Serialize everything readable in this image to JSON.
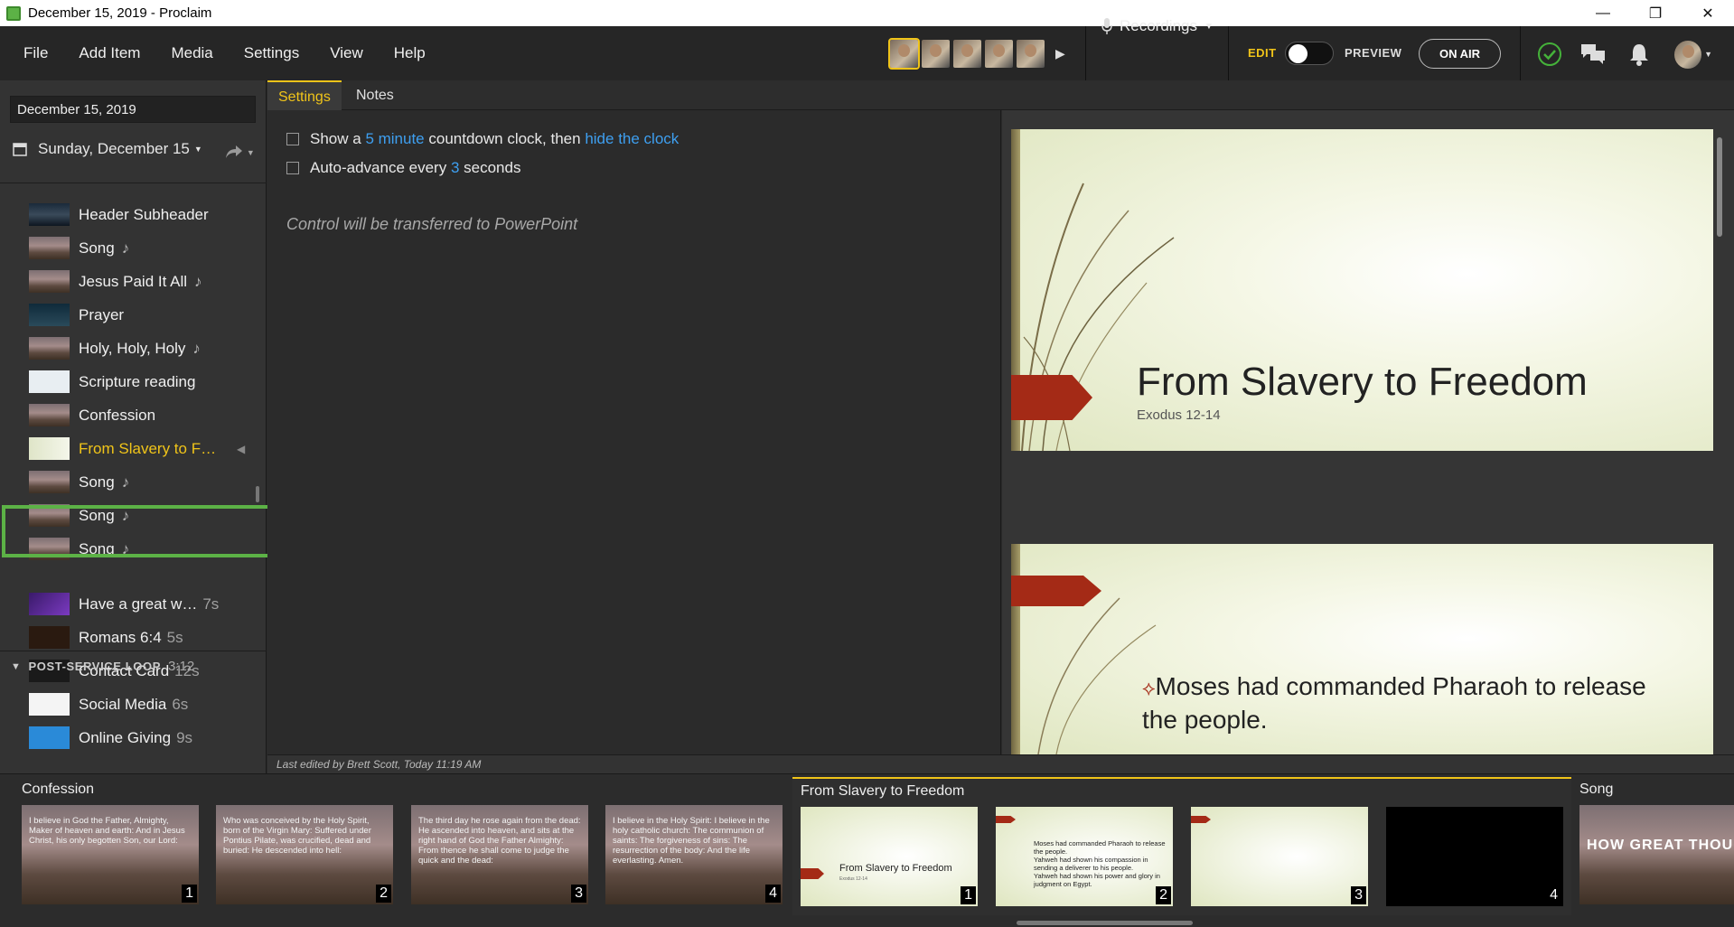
{
  "window": {
    "title": "December 15, 2019 - Proclaim",
    "controls": [
      "—",
      "❐",
      "✕"
    ]
  },
  "menu": [
    "File",
    "Add Item",
    "Media",
    "Settings",
    "View",
    "Help"
  ],
  "toolbar": {
    "recordings_label": "Recordings",
    "edit_label": "EDIT",
    "preview_label": "PREVIEW",
    "onair_label": "ON AIR"
  },
  "sidebar": {
    "date_field": "December 15, 2019",
    "date_selector": "Sunday, December 15",
    "items": [
      {
        "label": "Header Subheader",
        "thumb": "t-dark",
        "music": ""
      },
      {
        "label": "Song",
        "thumb": "t-mtn",
        "music": "♪"
      },
      {
        "label": "Jesus Paid It All",
        "thumb": "t-mtn",
        "music": "♪"
      },
      {
        "label": "Prayer",
        "thumb": "t-pray",
        "music": ""
      },
      {
        "label": "Holy, Holy, Holy",
        "thumb": "t-mtn",
        "music": "♪"
      },
      {
        "label": "Scripture reading",
        "thumb": "t-doc",
        "music": ""
      },
      {
        "label": "Confession",
        "thumb": "t-mtn",
        "music": ""
      },
      {
        "label": "From Slavery to F…",
        "thumb": "t-slide",
        "music": "",
        "selected": true
      },
      {
        "label": "Song",
        "thumb": "t-mtn",
        "music": "♪"
      },
      {
        "label": "Song",
        "thumb": "t-mtn",
        "music": "♪"
      },
      {
        "label": "Song",
        "thumb": "t-mtn",
        "music": "♪"
      }
    ],
    "section": {
      "name": "POST-SERVICE LOOP",
      "duration": "3:12"
    },
    "loop_items": [
      {
        "label": "Have a great w…",
        "duration": "7s",
        "thumb": "t-purple"
      },
      {
        "label": "Romans 6:4",
        "duration": "5s",
        "thumb": "t-romans"
      },
      {
        "label": "Contact Card",
        "duration": "12s",
        "thumb": "t-contact"
      },
      {
        "label": "Social Media",
        "duration": "6s",
        "thumb": "t-social"
      },
      {
        "label": "Online Giving",
        "duration": "9s",
        "thumb": "t-give"
      }
    ]
  },
  "tabs": [
    "Settings",
    "Notes"
  ],
  "settings": {
    "countdown": {
      "pre": "Show a",
      "minutes": "5 minute",
      "mid": "countdown clock, then",
      "link": "hide the clock"
    },
    "autoadvance": {
      "pre": "Auto-advance every",
      "secs": "3",
      "post": "seconds"
    },
    "control_note": "Control will be transferred to PowerPoint",
    "last_edited": "Last edited by Brett Scott, Today 11:19 AM"
  },
  "preview": {
    "slide1": {
      "title": "From Slavery to Freedom",
      "subtitle": "Exodus 12-14"
    },
    "slide2": {
      "bullet": "Moses had commanded Pharaoh to release the people."
    }
  },
  "strip": {
    "confession": {
      "header": "Confession",
      "slides": [
        {
          "text": "I believe in God the Father, Almighty, Maker of heaven and earth: And in Jesus Christ, his only begotten Son, our Lord:",
          "num": "1"
        },
        {
          "text": "Who was conceived by the Holy Spirit, born of the Virgin Mary: Suffered under Pontius Pilate, was crucified, dead and buried: He descended into hell:",
          "num": "2"
        },
        {
          "text": "The third day he rose again from the dead: He ascended into heaven, and sits at the right hand of God the Father Almighty: From thence he shall come to judge the quick and the dead:",
          "num": "3"
        },
        {
          "text": "I believe in the Holy Spirit: I believe in the holy catholic church: The communion of saints: The forgiveness of sins: The resurrection of the body: And the life everlasting. Amen.",
          "num": "4"
        }
      ]
    },
    "sermon": {
      "header": "From Slavery to Freedom",
      "title_slide": "From Slavery to Freedom",
      "title_sub": "Exodus 12-14",
      "bullets": [
        "Moses had commanded Pharaoh to release the people.",
        "Yahweh had shown his compassion in sending a deliverer to his people.",
        "Yahweh had shown his power and glory in judgment on Egypt."
      ],
      "nums": [
        "1",
        "2",
        "3",
        "4"
      ]
    },
    "song": {
      "header": "Song",
      "text": "HOW GREAT THOU"
    }
  }
}
